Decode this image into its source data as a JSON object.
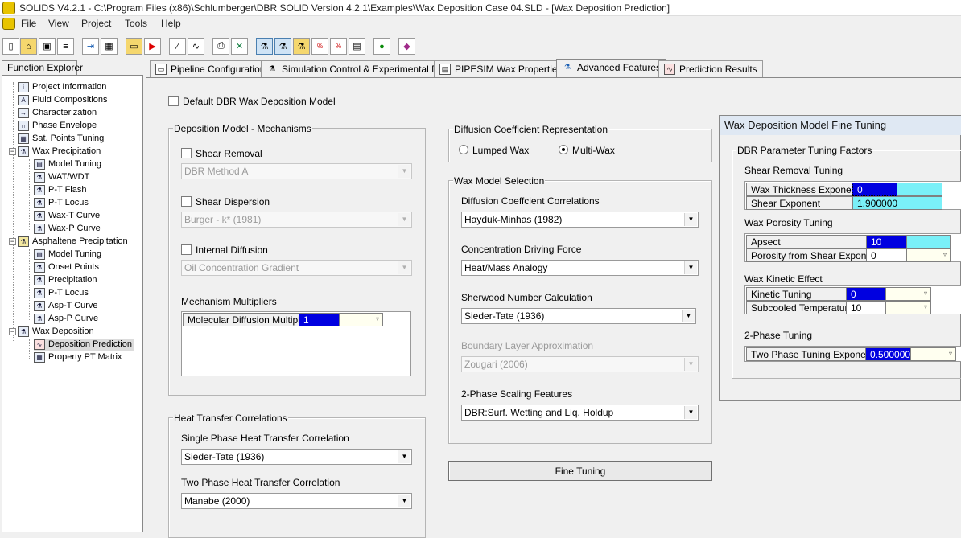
{
  "window": {
    "title": "SOLIDS V4.2.1 - C:\\Program Files (x86)\\Schlumberger\\DBR SOLID Version 4.2.1\\Examples\\Wax Deposition Case 04.SLD - [Wax Deposition Prediction]"
  },
  "menu": [
    "File",
    "View",
    "Project",
    "Tools",
    "Help"
  ],
  "explorer": {
    "tab_label": "Function Explorer",
    "items": [
      {
        "label": "Project Information",
        "icon": "project-info-icon"
      },
      {
        "label": "Fluid Compositions",
        "icon": "fluid-compositions-icon"
      },
      {
        "label": "Characterization",
        "icon": "characterization-icon"
      },
      {
        "label": "Phase Envelope",
        "icon": "phase-envelope-icon"
      },
      {
        "label": "Sat. Points Tuning",
        "icon": "sat-points-icon"
      },
      {
        "label": "Wax Precipitation",
        "icon": "wax-precipitation-icon"
      },
      {
        "label": "Model Tuning",
        "icon": "model-tuning-icon"
      },
      {
        "label": "WAT/WDT",
        "icon": "flask-icon"
      },
      {
        "label": "P-T Flash",
        "icon": "flask-icon"
      },
      {
        "label": "P-T Locus",
        "icon": "flask-icon"
      },
      {
        "label": "Wax-T Curve",
        "icon": "flask-icon"
      },
      {
        "label": "Wax-P Curve",
        "icon": "flask-icon"
      },
      {
        "label": "Asphaltene Precipitation",
        "icon": "asphaltene-precipitation-icon"
      },
      {
        "label": "Model Tuning",
        "icon": "model-tuning-icon"
      },
      {
        "label": "Onset Points",
        "icon": "flask-icon"
      },
      {
        "label": "Precipitation",
        "icon": "flask-icon"
      },
      {
        "label": "P-T Locus",
        "icon": "flask-icon"
      },
      {
        "label": "Asp-T Curve",
        "icon": "flask-icon"
      },
      {
        "label": "Asp-P Curve",
        "icon": "flask-icon"
      },
      {
        "label": "Wax Deposition",
        "icon": "wax-deposition-icon"
      },
      {
        "label": "Deposition Prediction",
        "icon": "deposition-prediction-icon"
      },
      {
        "label": "Property PT Matrix",
        "icon": "matrix-icon"
      }
    ]
  },
  "tabs": [
    {
      "label": "Pipeline Configuration"
    },
    {
      "label": "Simulation Control & Experimental Data"
    },
    {
      "label": "PIPESIM Wax Properties"
    },
    {
      "label": "Advanced Features"
    },
    {
      "label": "Prediction Results"
    }
  ],
  "main": {
    "default_model_label": "Default DBR Wax Deposition Model",
    "mechanisms": {
      "legend": "Deposition Model - Mechanisms",
      "shear_removal_label": "Shear Removal",
      "shear_removal_value": "DBR Method A",
      "shear_dispersion_label": "Shear Dispersion",
      "shear_dispersion_value": "Burger - k* (1981)",
      "internal_diffusion_label": "Internal Diffusion",
      "internal_diffusion_value": "Oil  Concentration Gradient",
      "multipliers_label": "Mechanism Multipliers",
      "multiplier_name": "Molecular Diffusion Multiplier",
      "multiplier_value": "1"
    },
    "heat_transfer": {
      "legend": "Heat Transfer Correlations",
      "single_label": "Single Phase Heat Transfer Correlation",
      "single_value": "Sieder-Tate (1936)",
      "two_label": "Two Phase Heat Transfer Correlation",
      "two_value": "Manabe (2000)"
    },
    "diffusion_rep": {
      "legend": "Diffusion Coefficient Representation",
      "lumped_label": "Lumped Wax",
      "multi_label": "Multi-Wax"
    },
    "wax_model": {
      "legend": "Wax Model Selection",
      "diff_corr_label": "Diffusion Coeffcient Correlations",
      "diff_corr_value": "Hayduk-Minhas (1982)",
      "conc_label": "Concentration Driving Force",
      "conc_value": "Heat/Mass Analogy",
      "sherwood_label": "Sherwood Number Calculation",
      "sherwood_value": "Sieder-Tate (1936)",
      "boundary_label": "Boundary Layer Approximation",
      "boundary_value": "Zougari (2006)",
      "scaling_label": "2-Phase Scaling Features",
      "scaling_value": "DBR:Surf. Wetting and Liq. Holdup"
    },
    "fine_tuning_button": "Fine Tuning"
  },
  "fine_tuning": {
    "title": "Wax Deposition Model Fine Tuning",
    "legend": "DBR Parameter  Tuning Factors",
    "shear_section": "Shear Removal Tuning",
    "wax_thickness_label": "Wax Thickness Exponent",
    "wax_thickness_value": "0",
    "shear_exponent_label": "Shear Exponent",
    "shear_exponent_value": "1.900000",
    "porosity_section": "Wax Porosity Tuning",
    "aspect_label": "Apsect",
    "aspect_value": "10",
    "porosity_shear_label": "Porosity from Shear Exponent",
    "porosity_shear_value": "0",
    "kinetic_section": "Wax Kinetic Effect",
    "kinetic_label": "Kinetic Tuning",
    "kinetic_value": "0",
    "subcooled_label": "Subcooled Temperature",
    "subcooled_value": "10",
    "twophase_section": "2-Phase Tuning",
    "twophase_label": "Two Phase Tuning Exponent",
    "twophase_value": "0.500000"
  }
}
